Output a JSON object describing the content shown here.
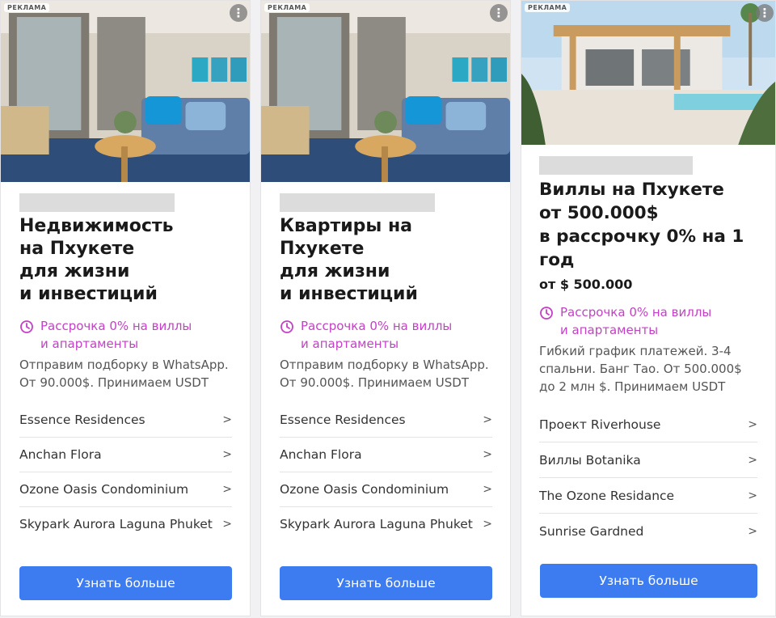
{
  "ad_label": "РЕКЛАМА",
  "cta_label": "Узнать больше",
  "colors": {
    "accent": "#c440c6",
    "button": "#3d7bf0"
  },
  "icons": {
    "promo": "clock-icon",
    "more": "more-vertical-icon",
    "link": "chevron-right-icon"
  },
  "cards": [
    {
      "title": "Недвижимость\nна Пхукете\nдля жизни\nи инвестиций",
      "promo": "Рассрочка 0% на виллы\nи апартаменты",
      "description": "Отправим подборку в WhatsApp. От 90.000$. Принимаем USDT",
      "links": [
        "Essence Residences",
        "Anchan Flora",
        "Ozone Oasis Condominium",
        "Skypark Aurora Laguna Phuket"
      ]
    },
    {
      "title": "Квартиры на Пхукете\nдля жизни\nи инвестиций",
      "promo": "Рассрочка 0% на виллы\nи апартаменты",
      "description": "Отправим подборку в WhatsApp. От 90.000$. Принимаем USDT",
      "links": [
        "Essence Residences",
        "Anchan Flora",
        "Ozone Oasis Condominium",
        "Skypark Aurora Laguna Phuket"
      ]
    },
    {
      "title": "Виллы на Пхукете\nот 500.000$\nв рассрочку 0% на 1\nгод",
      "price": "от $ 500.000",
      "promo": "Рассрочка 0% на виллы\nи апартаменты",
      "description": "Гибкий график платежей. 3-4 спальни. Банг Тао. От 500.000$ до 2 млн $. Принимаем USDT",
      "links": [
        "Проект Riverhouse",
        "Виллы Botanika",
        "The Ozone Residance",
        "Sunrise Gardned"
      ]
    }
  ]
}
